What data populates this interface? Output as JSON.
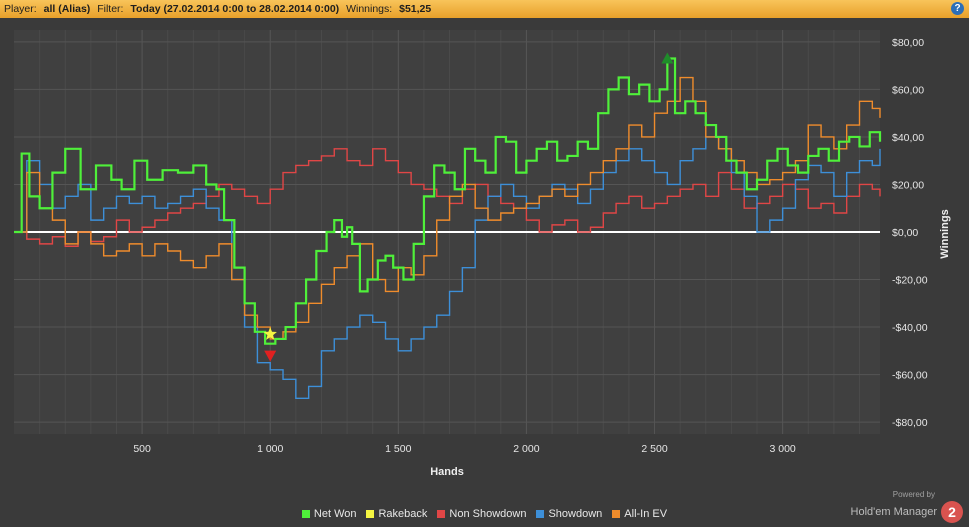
{
  "header": {
    "player_label": "Player:",
    "player_value": "all (Alias)",
    "filter_label": "Filter:",
    "filter_value": "Today (27.02.2014 0:00 to 28.02.2014 0:00)",
    "winnings_label": "Winnings:",
    "winnings_value": "$51,25",
    "help": "?"
  },
  "branding": {
    "powered": "Powered by",
    "name": "Hold'em Manager",
    "logo": "2"
  },
  "chart_data": {
    "type": "line",
    "xlabel": "Hands",
    "ylabel": "Winnings",
    "xlim": [
      0,
      3380
    ],
    "ylim": [
      -85,
      85
    ],
    "x_ticks": [
      500,
      1000,
      1500,
      2000,
      2500,
      3000
    ],
    "x_tick_labels": [
      "500",
      "1 000",
      "1 500",
      "2 000",
      "2 500",
      "3 000"
    ],
    "y_ticks": [
      80,
      60,
      40,
      20,
      0,
      -20,
      -40,
      -60,
      -80
    ],
    "y_tick_labels": [
      "$80,00",
      "$60,00",
      "$40,00",
      "$20,00",
      "$0,00",
      "-$20,00",
      "-$40,00",
      "-$60,00",
      "-$80,00"
    ],
    "grid": true,
    "legend_position": "bottom",
    "zero_line_color": "#ffffff",
    "series": [
      {
        "name": "Net Won",
        "color": "#4ff03a",
        "x": [
          0,
          30,
          60,
          100,
          150,
          200,
          260,
          320,
          380,
          420,
          470,
          520,
          580,
          640,
          700,
          750,
          790,
          820,
          860,
          900,
          940,
          980,
          1020,
          1060,
          1100,
          1140,
          1180,
          1220,
          1250,
          1280,
          1300,
          1320,
          1350,
          1380,
          1420,
          1450,
          1480,
          1520,
          1560,
          1600,
          1640,
          1680,
          1720,
          1760,
          1800,
          1840,
          1880,
          1920,
          1960,
          2000,
          2040,
          2080,
          2120,
          2160,
          2200,
          2240,
          2280,
          2320,
          2360,
          2400,
          2440,
          2480,
          2520,
          2550,
          2580,
          2620,
          2660,
          2700,
          2740,
          2780,
          2820,
          2860,
          2900,
          2940,
          2980,
          3020,
          3060,
          3100,
          3140,
          3180,
          3220,
          3260,
          3300,
          3340,
          3380
        ],
        "y": [
          0,
          33,
          15,
          10,
          25,
          35,
          18,
          28,
          22,
          18,
          30,
          22,
          26,
          25,
          28,
          20,
          18,
          5,
          -15,
          -30,
          -42,
          -47,
          -45,
          -40,
          -30,
          -20,
          -8,
          0,
          5,
          -2,
          2,
          -5,
          -25,
          -20,
          -12,
          -10,
          -15,
          -20,
          -5,
          15,
          28,
          25,
          18,
          35,
          30,
          25,
          40,
          38,
          25,
          30,
          35,
          38,
          30,
          32,
          38,
          35,
          50,
          60,
          65,
          58,
          62,
          55,
          60,
          73,
          50,
          55,
          50,
          45,
          40,
          30,
          25,
          18,
          22,
          30,
          35,
          28,
          25,
          32,
          35,
          30,
          38,
          40,
          36,
          42,
          38
        ]
      },
      {
        "name": "Rakeback",
        "color": "#f5f542",
        "x": [
          1000
        ],
        "y": [
          -43
        ]
      },
      {
        "name": "Non Showdown",
        "color": "#e04646",
        "x": [
          0,
          50,
          100,
          150,
          200,
          250,
          300,
          350,
          400,
          450,
          500,
          550,
          600,
          650,
          700,
          750,
          800,
          850,
          900,
          950,
          1000,
          1050,
          1100,
          1150,
          1200,
          1250,
          1300,
          1350,
          1400,
          1450,
          1500,
          1550,
          1600,
          1650,
          1700,
          1750,
          1800,
          1850,
          1900,
          1950,
          2000,
          2050,
          2100,
          2150,
          2200,
          2250,
          2300,
          2350,
          2400,
          2450,
          2500,
          2550,
          2600,
          2650,
          2700,
          2750,
          2800,
          2850,
          2900,
          2950,
          3000,
          3050,
          3100,
          3150,
          3200,
          3250,
          3300,
          3350,
          3380
        ],
        "y": [
          0,
          -3,
          -5,
          -2,
          -6,
          0,
          -4,
          -2,
          5,
          0,
          2,
          5,
          8,
          10,
          12,
          15,
          20,
          18,
          15,
          12,
          18,
          25,
          28,
          30,
          32,
          35,
          30,
          28,
          35,
          30,
          25,
          20,
          18,
          15,
          12,
          18,
          20,
          15,
          12,
          10,
          5,
          0,
          3,
          5,
          0,
          2,
          8,
          12,
          15,
          10,
          12,
          15,
          18,
          20,
          15,
          25,
          18,
          10,
          12,
          15,
          20,
          18,
          10,
          12,
          8,
          15,
          20,
          18,
          15
        ]
      },
      {
        "name": "Showdown",
        "color": "#3d8fd8",
        "x": [
          0,
          50,
          100,
          150,
          200,
          250,
          300,
          350,
          400,
          450,
          500,
          550,
          600,
          650,
          700,
          750,
          800,
          850,
          900,
          950,
          1000,
          1050,
          1100,
          1150,
          1200,
          1250,
          1300,
          1350,
          1400,
          1450,
          1500,
          1550,
          1600,
          1650,
          1700,
          1750,
          1800,
          1850,
          1900,
          1950,
          2000,
          2050,
          2100,
          2150,
          2200,
          2250,
          2300,
          2350,
          2400,
          2450,
          2500,
          2550,
          2600,
          2650,
          2700,
          2750,
          2800,
          2850,
          2900,
          2950,
          3000,
          3050,
          3100,
          3150,
          3200,
          3250,
          3300,
          3350,
          3380
        ],
        "y": [
          0,
          30,
          20,
          10,
          15,
          20,
          5,
          10,
          15,
          12,
          15,
          10,
          12,
          15,
          18,
          10,
          5,
          -20,
          -40,
          -55,
          -58,
          -62,
          -70,
          -65,
          -50,
          -45,
          -40,
          -35,
          -38,
          -45,
          -50,
          -45,
          -40,
          -35,
          -25,
          -15,
          5,
          15,
          20,
          15,
          10,
          15,
          20,
          18,
          12,
          18,
          25,
          30,
          35,
          30,
          25,
          20,
          30,
          35,
          40,
          35,
          25,
          15,
          0,
          5,
          10,
          22,
          28,
          25,
          15,
          25,
          30,
          28,
          35
        ]
      },
      {
        "name": "All-In EV",
        "color": "#ef8c2c",
        "x": [
          0,
          50,
          100,
          150,
          200,
          250,
          300,
          350,
          400,
          450,
          500,
          550,
          600,
          650,
          700,
          750,
          800,
          850,
          900,
          950,
          1000,
          1050,
          1100,
          1150,
          1200,
          1250,
          1300,
          1350,
          1400,
          1450,
          1500,
          1550,
          1600,
          1650,
          1700,
          1750,
          1800,
          1850,
          1900,
          1950,
          2000,
          2050,
          2100,
          2150,
          2200,
          2250,
          2300,
          2350,
          2400,
          2450,
          2500,
          2550,
          2600,
          2650,
          2700,
          2750,
          2800,
          2850,
          2900,
          2950,
          3000,
          3050,
          3100,
          3150,
          3200,
          3250,
          3300,
          3350,
          3380
        ],
        "y": [
          0,
          25,
          10,
          5,
          -5,
          0,
          -5,
          -10,
          -8,
          -5,
          -10,
          -5,
          -8,
          -12,
          -15,
          -10,
          -5,
          -20,
          -35,
          -40,
          -45,
          -42,
          -38,
          -30,
          -22,
          -15,
          -10,
          -5,
          -20,
          -25,
          -15,
          -18,
          -10,
          5,
          15,
          20,
          10,
          5,
          8,
          10,
          12,
          15,
          18,
          15,
          20,
          25,
          30,
          35,
          45,
          40,
          50,
          55,
          65,
          55,
          40,
          35,
          30,
          25,
          20,
          22,
          25,
          30,
          45,
          40,
          35,
          45,
          55,
          52,
          48
        ]
      }
    ],
    "markers": [
      {
        "label": "Net Won max",
        "x": 2550,
        "y": 73,
        "color": "#1f8c2a",
        "shape": "triangle-up"
      },
      {
        "label": "Net Won min",
        "x": 1000,
        "y": -52,
        "color": "#e02020",
        "shape": "triangle-down"
      },
      {
        "label": "Rakeback",
        "x": 1000,
        "y": -43,
        "color": "#f5f542",
        "shape": "star"
      }
    ]
  }
}
